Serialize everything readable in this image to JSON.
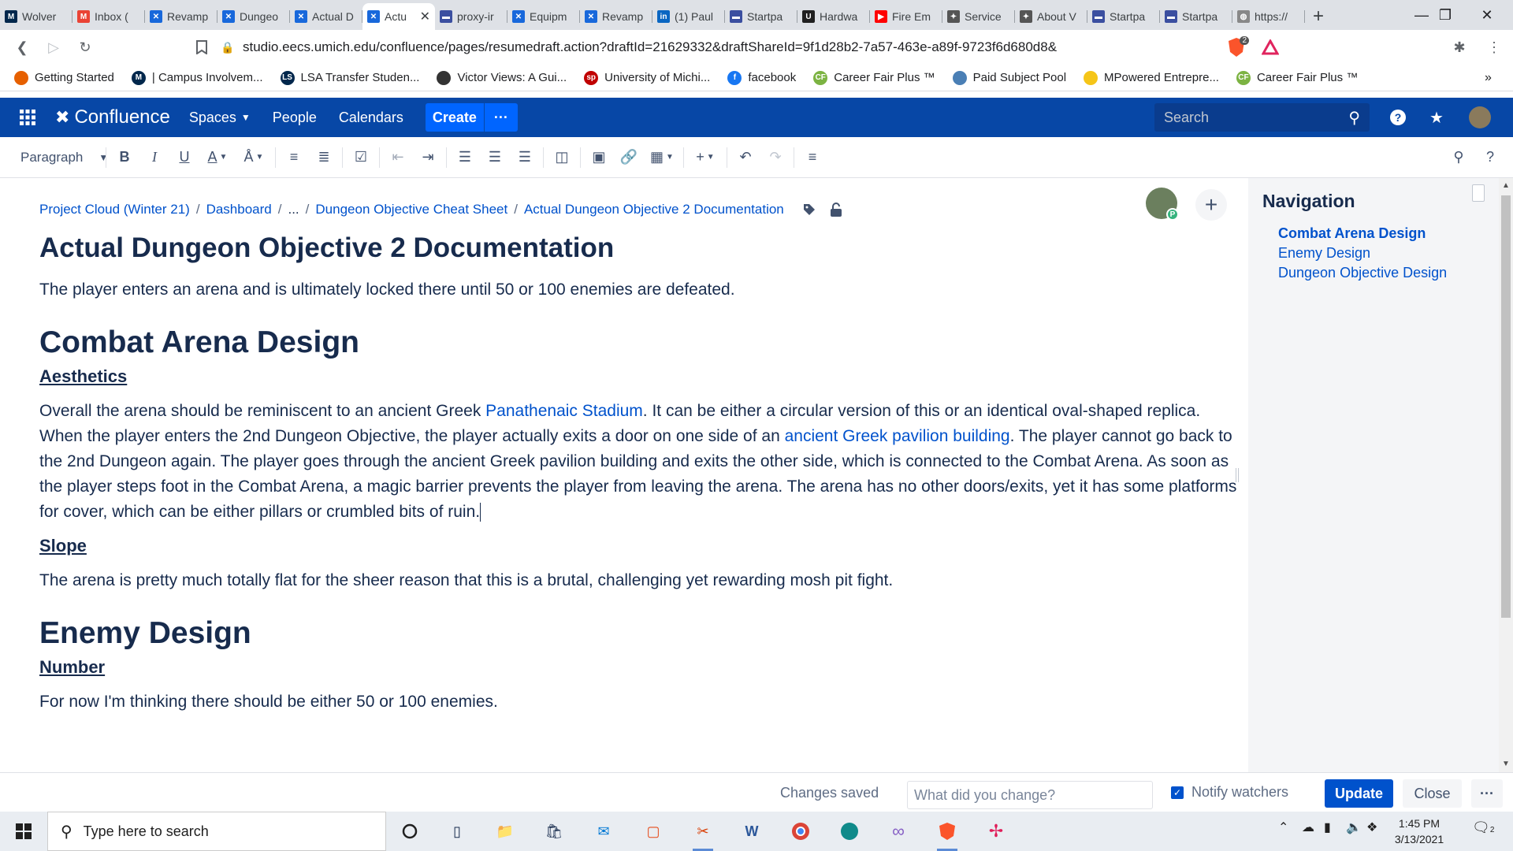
{
  "browser": {
    "tabs": [
      {
        "title": "Wolver",
        "color": "#00274c",
        "glyph": "M"
      },
      {
        "title": "Inbox (",
        "color": "#ea4335",
        "glyph": "M"
      },
      {
        "title": "Revamp",
        "color": "#1868db",
        "glyph": "✕"
      },
      {
        "title": "Dungeo",
        "color": "#1868db",
        "glyph": "✕"
      },
      {
        "title": "Actual D",
        "color": "#1868db",
        "glyph": "✕"
      },
      {
        "title": "Actu",
        "color": "#1868db",
        "glyph": "✕",
        "active": true
      },
      {
        "title": "proxy-ir",
        "color": "#3b4fa0",
        "glyph": "▬"
      },
      {
        "title": "Equipm",
        "color": "#1868db",
        "glyph": "✕"
      },
      {
        "title": "Revamp",
        "color": "#1868db",
        "glyph": "✕"
      },
      {
        "title": "(1) Paul",
        "color": "#0a66c2",
        "glyph": "in"
      },
      {
        "title": "Startpa",
        "color": "#3b4fa0",
        "glyph": "▬"
      },
      {
        "title": "Hardwa",
        "color": "#202020",
        "glyph": "U"
      },
      {
        "title": "Fire Em",
        "color": "#ff0000",
        "glyph": "▶"
      },
      {
        "title": "Service",
        "color": "#555555",
        "glyph": "✦"
      },
      {
        "title": "About V",
        "color": "#555555",
        "glyph": "✦"
      },
      {
        "title": "Startpa",
        "color": "#3b4fa0",
        "glyph": "▬"
      },
      {
        "title": "Startpa",
        "color": "#3b4fa0",
        "glyph": "▬"
      },
      {
        "title": "https://",
        "color": "#888888",
        "glyph": "◍"
      }
    ],
    "url": "studio.eecs.umich.edu/confluence/pages/resumedraft.action?draftId=21629332&draftShareId=9f1d28b2-7a57-463e-a89f-9723f6d680d8&",
    "brave_badge": "2",
    "bookmarks": [
      {
        "label": "Getting Started",
        "color": "#e66000",
        "glyph": ""
      },
      {
        "label": "| Campus Involvem...",
        "color": "#00274c",
        "glyph": "M"
      },
      {
        "label": "LSA Transfer Studen...",
        "color": "#00274c",
        "glyph": "LS"
      },
      {
        "label": "Victor Views: A Gui...",
        "color": "#333333",
        "glyph": ""
      },
      {
        "label": "University of Michi...",
        "color": "#c00000",
        "glyph": "sp"
      },
      {
        "label": "facebook",
        "color": "#1877f2",
        "glyph": "f"
      },
      {
        "label": "Career Fair Plus ™",
        "color": "#7cb342",
        "glyph": "CF"
      },
      {
        "label": "Paid Subject Pool",
        "color": "#4a7fb5",
        "glyph": ""
      },
      {
        "label": "MPowered Entrepre...",
        "color": "#f5c518",
        "glyph": ""
      },
      {
        "label": "Career Fair Plus ™",
        "color": "#7cb342",
        "glyph": "CF"
      }
    ]
  },
  "confluence": {
    "logo": "Confluence",
    "nav": {
      "spaces": "Spaces",
      "people": "People",
      "calendars": "Calendars"
    },
    "create": "Create",
    "more": "···",
    "search_placeholder": "Search"
  },
  "toolbar": {
    "paragraph": "Paragraph",
    "buttons": [
      "bold",
      "italic",
      "underline",
      "text-color",
      "text-style",
      "bullet-list",
      "numbered-list",
      "task",
      "outdent",
      "indent",
      "align-left",
      "align-center",
      "align-right",
      "layout",
      "image",
      "link",
      "table",
      "insert",
      "undo",
      "redo",
      "page-layout"
    ]
  },
  "page": {
    "breadcrumbs": [
      "Project Cloud (Winter 21)",
      "Dashboard",
      "...",
      "Dungeon Objective Cheat Sheet",
      "Actual Dungeon Objective 2 Documentation"
    ],
    "title": "Actual Dungeon Objective 2 Documentation",
    "intro": "The player enters an arena and is ultimately locked there until 50 or 100 enemies are defeated.",
    "sec1": {
      "heading": "Combat Arena Design",
      "aesthetics": "Aesthetics",
      "p_a": "Overall the arena should be reminiscent to an ancient Greek ",
      "link1": "Panathenaic Stadium",
      "p_b": ". It can be either a circular version of this or an identical oval-shaped replica. When the player enters the 2nd Dungeon Objective, the player actually exits a door on one side of an ",
      "link2": "ancient Greek pavilion building",
      "p_c": ". The player cannot go back to the 2nd Dungeon again. The player goes through the ancient Greek pavilion building and exits the other side, which is connected to the Combat Arena. As soon as the player steps foot in the Combat Arena, a magic barrier prevents the player from leaving the arena. The arena has no other doors/exits, yet it has some platforms for cover, which can be either pillars or crumbled bits of ruin.",
      "slope": "Slope",
      "slope_text": "The arena is pretty much totally flat for the sheer reason that this is a brutal, challenging yet rewarding mosh pit fight."
    },
    "sec2": {
      "heading": "Enemy Design",
      "number": "Number",
      "number_text": "For now I'm thinking there should be either 50 or 100 enemies."
    },
    "editor_badge": "P"
  },
  "navigation": {
    "title": "Navigation",
    "items": [
      "Combat Arena Design",
      "Enemy Design",
      "Dungeon Objective Design"
    ]
  },
  "savebar": {
    "status": "Changes saved",
    "change_placeholder": "What did you change?",
    "notify": "Notify watchers",
    "update": "Update",
    "close": "Close",
    "more": "···"
  },
  "taskbar": {
    "search": "Type here to search",
    "time": "1:45 PM",
    "date": "3/13/2021",
    "notif_count": "2"
  }
}
